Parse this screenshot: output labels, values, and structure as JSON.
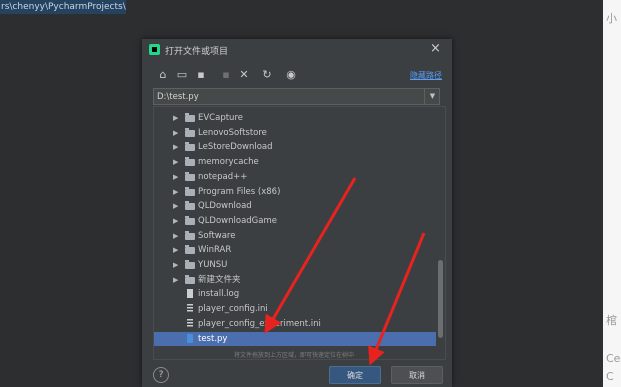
{
  "ide": {
    "path_text": "rs\\chenyy\\PycharmProjects\\p"
  },
  "right_strip": {
    "top_char": "小",
    "mid_char": "棺",
    "bottom_char1": "Ce",
    "bottom_char2": "C"
  },
  "dialog": {
    "title": "打开文件或项目",
    "close_label": "×",
    "toolbar_link": "隐藏路径",
    "path_value": "D:\\test.py",
    "hint_text": "将文件拖放到上方区域，即可快速定位在树中",
    "ok_label": "确定",
    "cancel_label": "取消",
    "help_label": "?"
  },
  "toolbar_icons": [
    "home-icon",
    "desktop-icon",
    "project-icon",
    "new-folder-icon",
    "delete-icon",
    "refresh-icon",
    "show-hidden-icon"
  ],
  "tree": {
    "rows": [
      {
        "label": "EVCapture",
        "type": "folder"
      },
      {
        "label": "LenovoSoftstore",
        "type": "folder"
      },
      {
        "label": "LeStoreDownload",
        "type": "folder"
      },
      {
        "label": "memorycache",
        "type": "folder"
      },
      {
        "label": "notepad++",
        "type": "folder"
      },
      {
        "label": "Program Files (x86)",
        "type": "folder"
      },
      {
        "label": "QLDownload",
        "type": "folder"
      },
      {
        "label": "QLDownloadGame",
        "type": "folder"
      },
      {
        "label": "Software",
        "type": "folder"
      },
      {
        "label": "WinRAR",
        "type": "folder"
      },
      {
        "label": "YUNSU",
        "type": "folder"
      },
      {
        "label": "新建文件夹",
        "type": "folder"
      },
      {
        "label": "install.log",
        "type": "file"
      },
      {
        "label": "player_config.ini",
        "type": "file"
      },
      {
        "label": "player_config_experiment.ini",
        "type": "file"
      },
      {
        "label": "test.py",
        "type": "py",
        "selected": true
      }
    ]
  },
  "colors": {
    "selection": "#4b6eaf",
    "link": "#589df6",
    "arrow": "#e8231f"
  }
}
